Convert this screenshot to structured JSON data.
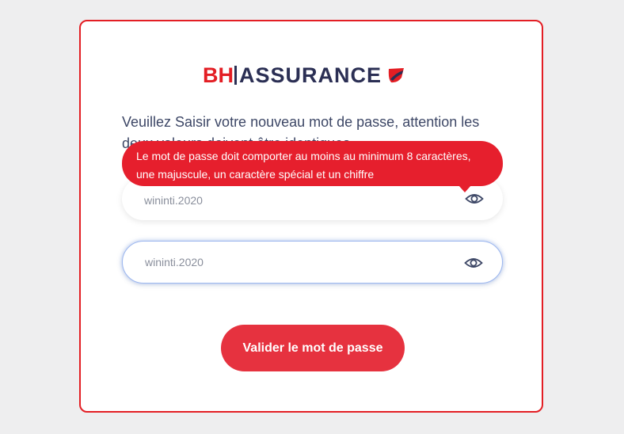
{
  "logo": {
    "brand_left": "BH",
    "brand_right": "ASSURANCE",
    "color_primary": "#e31e24",
    "color_secondary": "#2b2f54"
  },
  "form": {
    "instruction": "Veuillez Saisir votre nouveau mot de passe, attention les deux valeurs doivent être identiques",
    "tooltip_line1": "Le mot de passe doit comporter au moins au minimum 8 caractères,",
    "tooltip_line2": "une majuscule, un caractère spécial et un chiffre",
    "password_value": "wininti.2020",
    "confirm_value": "wininti.2020",
    "eye_icon": "eye-icon",
    "submit_label": "Valider le mot de passe"
  },
  "colors": {
    "border": "#e31e24",
    "tooltip_bg": "#e61f2d",
    "button_bg": "#e6323f",
    "focus_ring": "#9db7ef"
  }
}
